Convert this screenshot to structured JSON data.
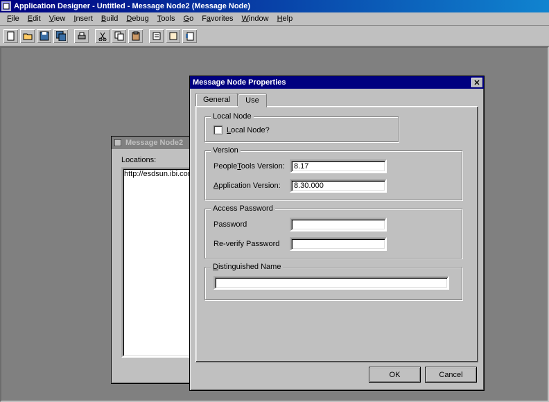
{
  "title": "Application Designer - Untitled - Message Node2 (Message Node)",
  "menu": {
    "file": "File",
    "edit": "Edit",
    "view": "View",
    "insert": "Insert",
    "build": "Build",
    "debug": "Debug",
    "tools": "Tools",
    "go": "Go",
    "favorites": "Favorites",
    "window": "Window",
    "help": "Help"
  },
  "toolbar": {
    "new": "new",
    "open": "open",
    "save": "save",
    "saveall": "save-all",
    "print": "print",
    "cut": "cut",
    "copy": "copy",
    "paste": "paste",
    "undo": "undo",
    "redo": "redo",
    "props": "properties"
  },
  "child_window": {
    "title": "Message Node2",
    "locations_label": "Locations:",
    "locations_value": "http://esdsun.ibi.com"
  },
  "dialog": {
    "title": "Message Node Properties",
    "close_glyph": "✕",
    "tabs": {
      "general": "General",
      "use": "Use"
    },
    "local_node": {
      "legend": "Local Node",
      "checkbox_label": "Local Node?"
    },
    "version": {
      "legend": "Version",
      "pt_label": "PeopleTools Version:",
      "pt_value": "8.17",
      "app_label": "Application Version:",
      "app_value": "8.30.000"
    },
    "access": {
      "legend": "Access Password",
      "pw_label": "Password",
      "pw_value": "",
      "rpw_label": "Re-verify Password",
      "rpw_value": ""
    },
    "dn": {
      "legend": "Distinguished Name",
      "value": ""
    },
    "buttons": {
      "ok": "OK",
      "cancel": "Cancel"
    }
  }
}
